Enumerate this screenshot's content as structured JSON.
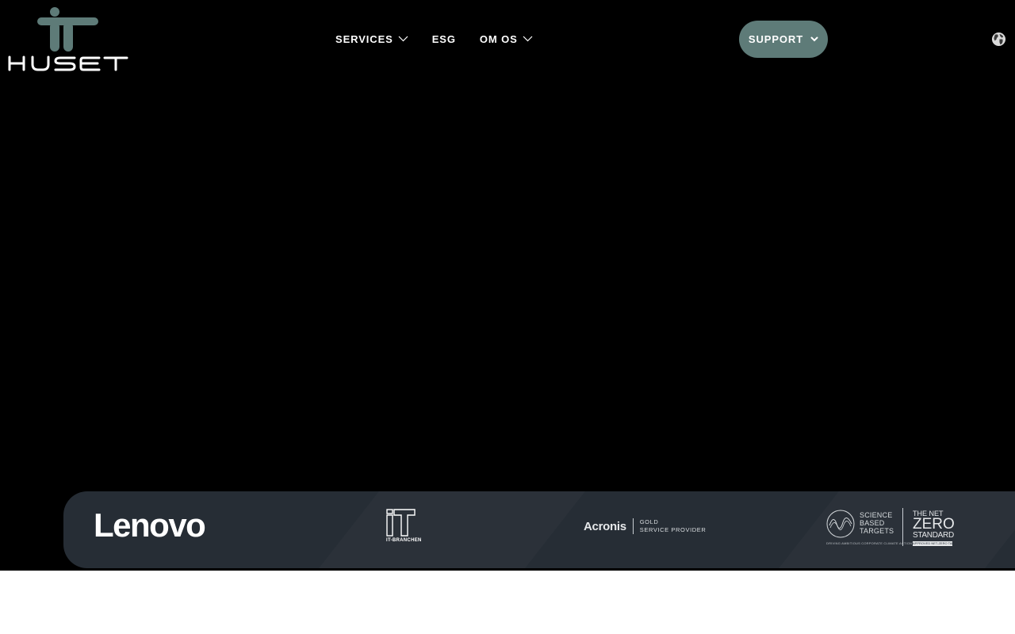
{
  "brand": {
    "logo_text": "HUSET",
    "logo_mark": "iT",
    "colors": {
      "accent": "#5e7b78",
      "hero_bg": "#000000",
      "strip_bg": "#262d35",
      "text": "#ffffff"
    }
  },
  "nav": {
    "items": [
      {
        "label": "SERVICES",
        "has_dropdown": true,
        "icon": "chevron-down-icon"
      },
      {
        "label": "ESG",
        "has_dropdown": false
      },
      {
        "label": "OM OS",
        "has_dropdown": true,
        "icon": "chevron-down-icon"
      }
    ]
  },
  "support": {
    "label": "SUPPORT",
    "icon": "chevron-down-icon"
  },
  "language": {
    "icon": "globe-icon"
  },
  "partners": [
    {
      "name": "Lenovo"
    },
    {
      "name": "IT-BRANCHEN",
      "mark": "iT"
    },
    {
      "name": "Acronis",
      "tagline_1": "GOLD",
      "tagline_2": "SERVICE PROVIDER"
    },
    {
      "sbt_1": "SCIENCE",
      "sbt_2": "BASED",
      "sbt_3": "TARGETS",
      "sbt_foot": "DRIVING AMBITIOUS CORPORATE CLIMATE ACTION",
      "nz_top": "THE NET",
      "nz_big": "ZERO",
      "nz_std": "STANDARD",
      "nz_badge": "APPROVED NET-ZERO TARGETS"
    }
  ]
}
